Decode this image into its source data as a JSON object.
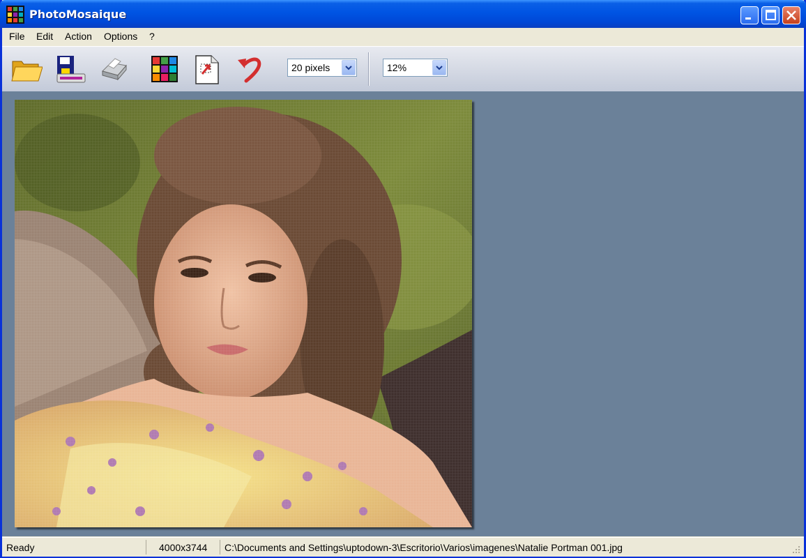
{
  "window": {
    "title": "PhotoMosaique"
  },
  "menu": {
    "items": [
      "File",
      "Edit",
      "Action",
      "Options",
      "?"
    ]
  },
  "toolbar": {
    "tools": [
      "open-folder-icon",
      "save-disk-icon",
      "print-icon",
      "mosaic-grid-icon",
      "export-document-icon",
      "undo-arrow-icon"
    ],
    "tile_size": "20 pixels",
    "zoom": "12%"
  },
  "status": {
    "state": "Ready",
    "dimensions": "4000x3744",
    "path": "C:\\Documents and Settings\\uptodown-3\\Escritorio\\Varios\\imagenes\\Natalie Portman 001.jpg"
  },
  "colors": {
    "titlebar": "#0054e3",
    "workspace": "#6b8199",
    "menu_bg": "#ece9d8"
  }
}
